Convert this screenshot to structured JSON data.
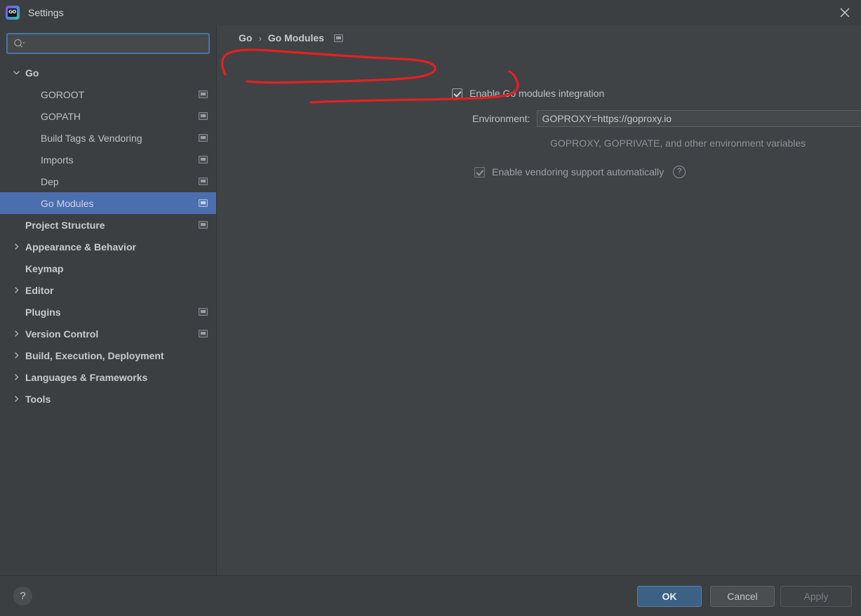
{
  "window": {
    "title": "Settings",
    "app_icon": "goland-icon",
    "icon_text": "GO",
    "close_icon": "close-icon"
  },
  "sidebar": {
    "search": {
      "placeholder": "",
      "value": "",
      "icon": "search-icon"
    },
    "items": [
      {
        "label": "Go",
        "level": 0,
        "twisty": "expanded",
        "bold": true,
        "badge": false,
        "selected": false
      },
      {
        "label": "GOROOT",
        "level": 1,
        "twisty": "none",
        "bold": false,
        "badge": true,
        "selected": false
      },
      {
        "label": "GOPATH",
        "level": 1,
        "twisty": "none",
        "bold": false,
        "badge": true,
        "selected": false
      },
      {
        "label": "Build Tags & Vendoring",
        "level": 1,
        "twisty": "none",
        "bold": false,
        "badge": true,
        "selected": false
      },
      {
        "label": "Imports",
        "level": 1,
        "twisty": "none",
        "bold": false,
        "badge": true,
        "selected": false
      },
      {
        "label": "Dep",
        "level": 1,
        "twisty": "none",
        "bold": false,
        "badge": true,
        "selected": false
      },
      {
        "label": "Go Modules",
        "level": 1,
        "twisty": "none",
        "bold": false,
        "badge": true,
        "selected": true
      },
      {
        "label": "Project Structure",
        "level": 0,
        "twisty": "none",
        "bold": true,
        "badge": true,
        "selected": false
      },
      {
        "label": "Appearance & Behavior",
        "level": 0,
        "twisty": "collapsed",
        "bold": true,
        "badge": false,
        "selected": false
      },
      {
        "label": "Keymap",
        "level": 0,
        "twisty": "none",
        "bold": true,
        "badge": false,
        "selected": false
      },
      {
        "label": "Editor",
        "level": 0,
        "twisty": "collapsed",
        "bold": true,
        "badge": false,
        "selected": false
      },
      {
        "label": "Plugins",
        "level": 0,
        "twisty": "none",
        "bold": true,
        "badge": true,
        "selected": false
      },
      {
        "label": "Version Control",
        "level": 0,
        "twisty": "collapsed",
        "bold": true,
        "badge": true,
        "selected": false
      },
      {
        "label": "Build, Execution, Deployment",
        "level": 0,
        "twisty": "collapsed",
        "bold": true,
        "badge": false,
        "selected": false
      },
      {
        "label": "Languages & Frameworks",
        "level": 0,
        "twisty": "collapsed",
        "bold": true,
        "badge": false,
        "selected": false
      },
      {
        "label": "Tools",
        "level": 0,
        "twisty": "collapsed",
        "bold": true,
        "badge": false,
        "selected": false
      }
    ]
  },
  "main": {
    "breadcrumb": {
      "root": "Go",
      "separator": "›",
      "current": "Go Modules",
      "badge_icon": "project-setting-icon"
    },
    "enable_modules": {
      "label": "Enable Go modules integration",
      "checked": true,
      "enabled": true
    },
    "environment": {
      "label": "Environment:",
      "value": "GOPROXY=https://goproxy.io",
      "placeholder": "",
      "expand_icon": "expand-editor-icon",
      "hint": "GOPROXY, GOPRIVATE, and other environment variables"
    },
    "vendoring": {
      "label": "Enable vendoring support automatically",
      "checked": true,
      "enabled": false,
      "help_icon": "help-circle-icon",
      "help_glyph": "?"
    }
  },
  "footer": {
    "help_glyph": "?",
    "help_icon": "help-circle-icon",
    "ok_label": "OK",
    "cancel_label": "Cancel",
    "apply_label": "Apply",
    "apply_enabled": false
  },
  "annotation": {
    "color": "#e62020",
    "shapes": [
      "circle-around-enable-go-modules-integration",
      "circle-around-environment-value"
    ]
  }
}
